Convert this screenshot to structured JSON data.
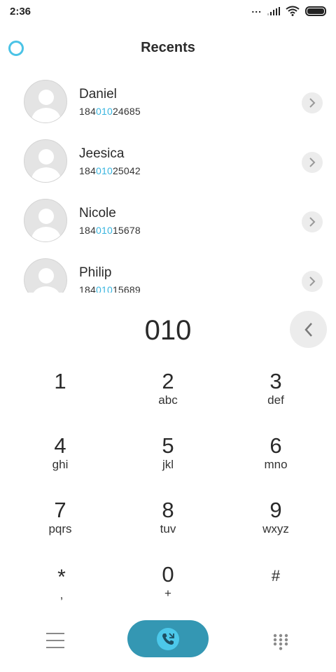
{
  "status_bar": {
    "time": "2:36",
    "icons": [
      "dots-icon",
      "signal-icon",
      "wifi-icon",
      "battery-icon"
    ],
    "dots": "..."
  },
  "header": {
    "title": "Recents",
    "icon": "circle-icon"
  },
  "search_match": "010",
  "contacts": [
    {
      "name": "Daniel",
      "number_prefix": "184",
      "number_match": "010",
      "number_suffix": "24685"
    },
    {
      "name": "Jeesica",
      "number_prefix": "184",
      "number_match": "010",
      "number_suffix": "25042"
    },
    {
      "name": "Nicole",
      "number_prefix": "184",
      "number_match": "010",
      "number_suffix": "15678"
    },
    {
      "name": "Philip",
      "number_prefix": "184",
      "number_match": "010",
      "number_suffix": "15689"
    }
  ],
  "dialer": {
    "entered_number": "010"
  },
  "keypad": [
    {
      "digit": "1",
      "letters": ""
    },
    {
      "digit": "2",
      "letters": "abc"
    },
    {
      "digit": "3",
      "letters": "def"
    },
    {
      "digit": "4",
      "letters": "ghi"
    },
    {
      "digit": "5",
      "letters": "jkl"
    },
    {
      "digit": "6",
      "letters": "mno"
    },
    {
      "digit": "7",
      "letters": "pqrs"
    },
    {
      "digit": "8",
      "letters": "tuv"
    },
    {
      "digit": "9",
      "letters": "wxyz"
    },
    {
      "digit": "*",
      "letters": ","
    },
    {
      "digit": "0",
      "letters": "+"
    },
    {
      "digit": "#",
      "letters": ""
    }
  ],
  "bottom_bar": {
    "icons": [
      "menu-icon",
      "phone-call-icon",
      "dialpad-icon"
    ]
  },
  "colors": {
    "accent": "#39b5df",
    "call_button": "#3497b3",
    "call_button_inner": "#4cc8ea"
  }
}
